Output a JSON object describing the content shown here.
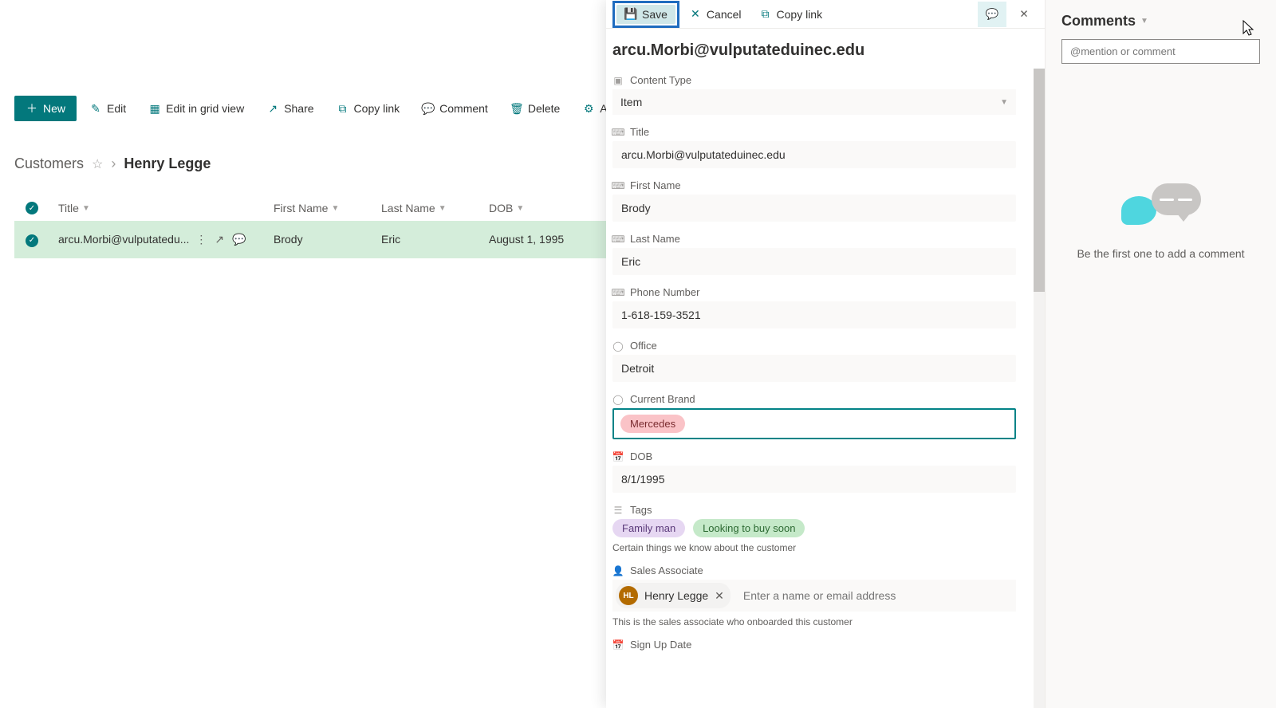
{
  "toolbar": {
    "new": "New",
    "edit": "Edit",
    "editGrid": "Edit in grid view",
    "share": "Share",
    "copyLink": "Copy link",
    "comment": "Comment",
    "delete": "Delete",
    "automate": "Automate"
  },
  "breadcrumb": {
    "list": "Customers",
    "current": "Henry Legge"
  },
  "grid": {
    "columns": {
      "title": "Title",
      "firstName": "First Name",
      "lastName": "Last Name",
      "dob": "DOB"
    },
    "rows": [
      {
        "title": "arcu.Morbi@vulputatedu...",
        "firstName": "Brody",
        "lastName": "Eric",
        "dob": "August 1, 1995"
      }
    ]
  },
  "panel": {
    "actions": {
      "save": "Save",
      "cancel": "Cancel",
      "copyLink": "Copy link"
    },
    "title": "arcu.Morbi@vulputateduinec.edu",
    "fields": {
      "contentType": {
        "label": "Content Type",
        "value": "Item"
      },
      "titleF": {
        "label": "Title",
        "value": "arcu.Morbi@vulputateduinec.edu"
      },
      "firstName": {
        "label": "First Name",
        "value": "Brody"
      },
      "lastName": {
        "label": "Last Name",
        "value": "Eric"
      },
      "phone": {
        "label": "Phone Number",
        "value": "1-618-159-3521"
      },
      "office": {
        "label": "Office",
        "value": "Detroit"
      },
      "currentBrand": {
        "label": "Current Brand",
        "value": "Mercedes"
      },
      "dob": {
        "label": "DOB",
        "value": "8/1/1995"
      },
      "tags": {
        "label": "Tags",
        "values": [
          "Family man",
          "Looking to buy soon"
        ],
        "help": "Certain things we know about the customer"
      },
      "salesAssociate": {
        "label": "Sales Associate",
        "personName": "Henry Legge",
        "initials": "HL",
        "placeholder": "Enter a name or email address",
        "help": "This is the sales associate who onboarded this customer"
      },
      "signUp": {
        "label": "Sign Up Date"
      }
    }
  },
  "comments": {
    "header": "Comments",
    "placeholder": "@mention or comment",
    "empty": "Be the first one to add a comment"
  }
}
